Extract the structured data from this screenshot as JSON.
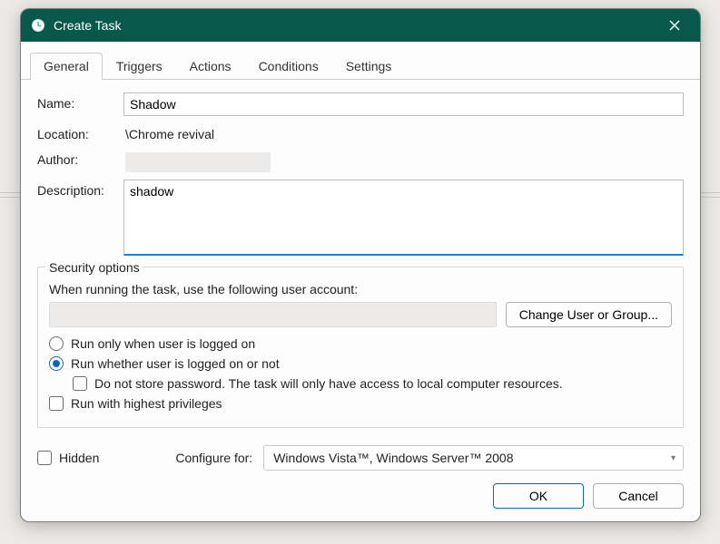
{
  "window": {
    "title": "Create Task"
  },
  "tabs": {
    "general": "General",
    "triggers": "Triggers",
    "actions": "Actions",
    "conditions": "Conditions",
    "settings": "Settings"
  },
  "general": {
    "labels": {
      "name": "Name:",
      "location": "Location:",
      "author": "Author:",
      "description": "Description:"
    },
    "name_value": "Shadow",
    "location_value": "\\Chrome revival",
    "author_value": "",
    "description_value": "shadow"
  },
  "security": {
    "legend": "Security options",
    "prompt": "When running the task, use the following user account:",
    "change_user_btn": "Change User or Group...",
    "account_display": "",
    "radio_logged_on": "Run only when user is logged on",
    "radio_whether": "Run whether user is logged on or not",
    "chk_nostore": "Do not store password.  The task will only have access to local computer resources.",
    "chk_highest": "Run with highest privileges",
    "selected_radio": "whether",
    "nostore_checked": false,
    "highest_checked": false
  },
  "bottom": {
    "hidden_label": "Hidden",
    "hidden_checked": false,
    "configure_label": "Configure for:",
    "configure_value": "Windows Vista™, Windows Server™ 2008"
  },
  "buttons": {
    "ok": "OK",
    "cancel": "Cancel"
  }
}
